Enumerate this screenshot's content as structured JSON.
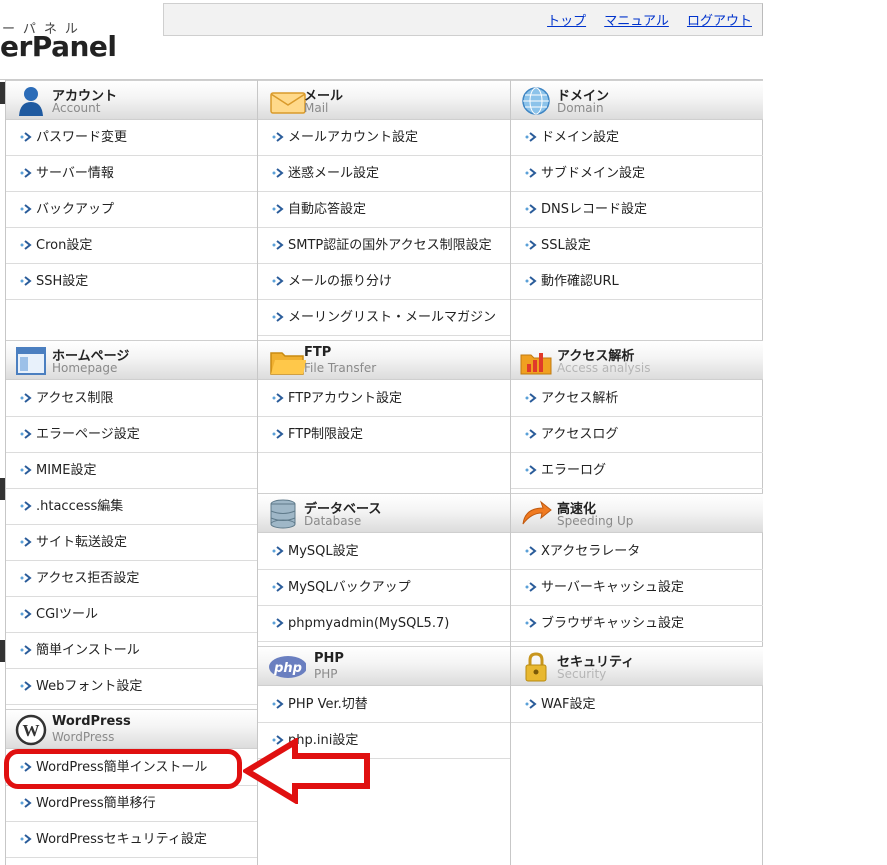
{
  "header": {
    "logo_kana": "ーパネル",
    "logo_main": "erPanel",
    "links": [
      "トップ",
      "マニュアル",
      "ログアウト"
    ]
  },
  "sections": {
    "account": {
      "title": "アカウント",
      "sub": "Account",
      "items": [
        "パスワード変更",
        "サーバー情報",
        "バックアップ",
        "Cron設定",
        "SSH設定"
      ]
    },
    "mail": {
      "title": "メール",
      "sub": "Mail",
      "items": [
        "メールアカウント設定",
        "迷惑メール設定",
        "自動応答設定",
        "SMTP認証の国外アクセス制限設定",
        "メールの振り分け",
        "メーリングリスト・メールマガジン"
      ]
    },
    "domain": {
      "title": "ドメイン",
      "sub": "Domain",
      "items": [
        "ドメイン設定",
        "サブドメイン設定",
        "DNSレコード設定",
        "SSL設定",
        "動作確認URL"
      ]
    },
    "homepage": {
      "title": "ホームページ",
      "sub": "Homepage",
      "items": [
        "アクセス制限",
        "エラーページ設定",
        "MIME設定",
        ".htaccess編集",
        "サイト転送設定",
        "アクセス拒否設定",
        "CGIツール",
        "簡単インストール",
        "Webフォント設定"
      ]
    },
    "ftp": {
      "title": "FTP",
      "sub": "File Transfer",
      "items": [
        "FTPアカウント設定",
        "FTP制限設定"
      ]
    },
    "access": {
      "title": "アクセス解析",
      "sub": "Access analysis",
      "items": [
        "アクセス解析",
        "アクセスログ",
        "エラーログ"
      ]
    },
    "database": {
      "title": "データベース",
      "sub": "Database",
      "items": [
        "MySQL設定",
        "MySQLバックアップ",
        "phpmyadmin(MySQL5.7)"
      ]
    },
    "speed": {
      "title": "高速化",
      "sub": "Speeding Up",
      "items": [
        "Xアクセラレータ",
        "サーバーキャッシュ設定",
        "ブラウザキャッシュ設定"
      ]
    },
    "php": {
      "title": "PHP",
      "sub": "PHP",
      "items": [
        "PHP Ver.切替",
        "php.ini設定"
      ]
    },
    "security": {
      "title": "セキュリティ",
      "sub": "Security",
      "items": [
        "WAF設定"
      ]
    },
    "wordpress": {
      "title": "WordPress",
      "sub": "WordPress",
      "items": [
        "WordPress簡単インストール",
        "WordPress簡単移行",
        "WordPressセキュリティ設定"
      ]
    }
  },
  "icons": {
    "php_badge": "php"
  },
  "colors": {
    "link": "#0033cc",
    "highlight": "#e01010"
  }
}
